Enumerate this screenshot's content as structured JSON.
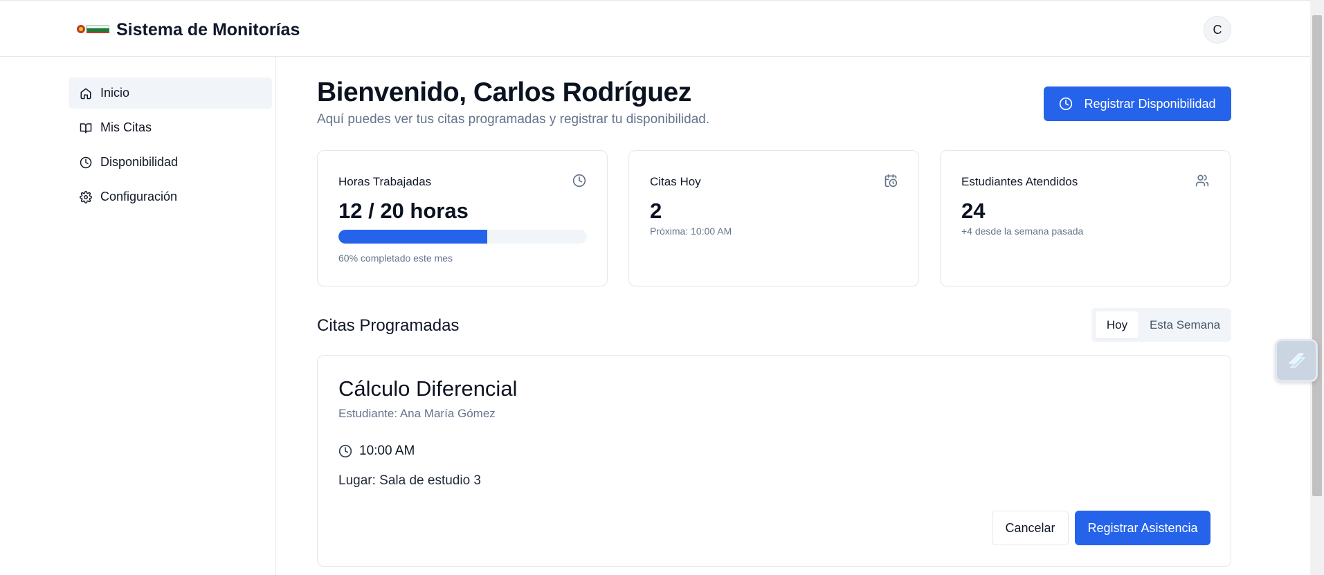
{
  "header": {
    "app_title": "Sistema de Monitorías",
    "avatar_initial": "C"
  },
  "sidebar": {
    "items": [
      {
        "label": "Inicio",
        "icon": "home-icon",
        "active": true
      },
      {
        "label": "Mis Citas",
        "icon": "book-open-icon",
        "active": false
      },
      {
        "label": "Disponibilidad",
        "icon": "clock-icon",
        "active": false
      },
      {
        "label": "Configuración",
        "icon": "gear-icon",
        "active": false
      }
    ]
  },
  "main": {
    "welcome": "Bienvenido, Carlos Rodríguez",
    "subtitle": "Aquí puedes ver tus citas programadas y registrar tu disponibilidad.",
    "register_availability_label": "Registrar Disponibilidad",
    "cards": [
      {
        "title": "Horas Trabajadas",
        "icon": "clock-icon",
        "value": "12 / 20 horas",
        "progress": 0.6,
        "note": "60% completado este mes"
      },
      {
        "title": "Citas Hoy",
        "icon": "calendar-clock-icon",
        "value": "2",
        "note": "Próxima: 10:00 AM"
      },
      {
        "title": "Estudiantes Atendidos",
        "icon": "users-icon",
        "value": "24",
        "note": "+4 desde la semana pasada"
      }
    ],
    "section_title": "Citas Programadas",
    "tabs": [
      {
        "label": "Hoy",
        "active": true
      },
      {
        "label": "Esta Semana",
        "active": false
      }
    ],
    "appointment": {
      "subject": "Cálculo Diferencial",
      "student": "Estudiante: Ana María Gómez",
      "time": "10:00 AM",
      "place": "Lugar: Sala de estudio 3",
      "cancel_label": "Cancelar",
      "attend_label": "Registrar Asistencia"
    }
  },
  "colors": {
    "primary": "#2563eb",
    "muted_text": "#64748b",
    "border": "#e5e7eb",
    "active_nav_bg": "#f1f5f9"
  }
}
